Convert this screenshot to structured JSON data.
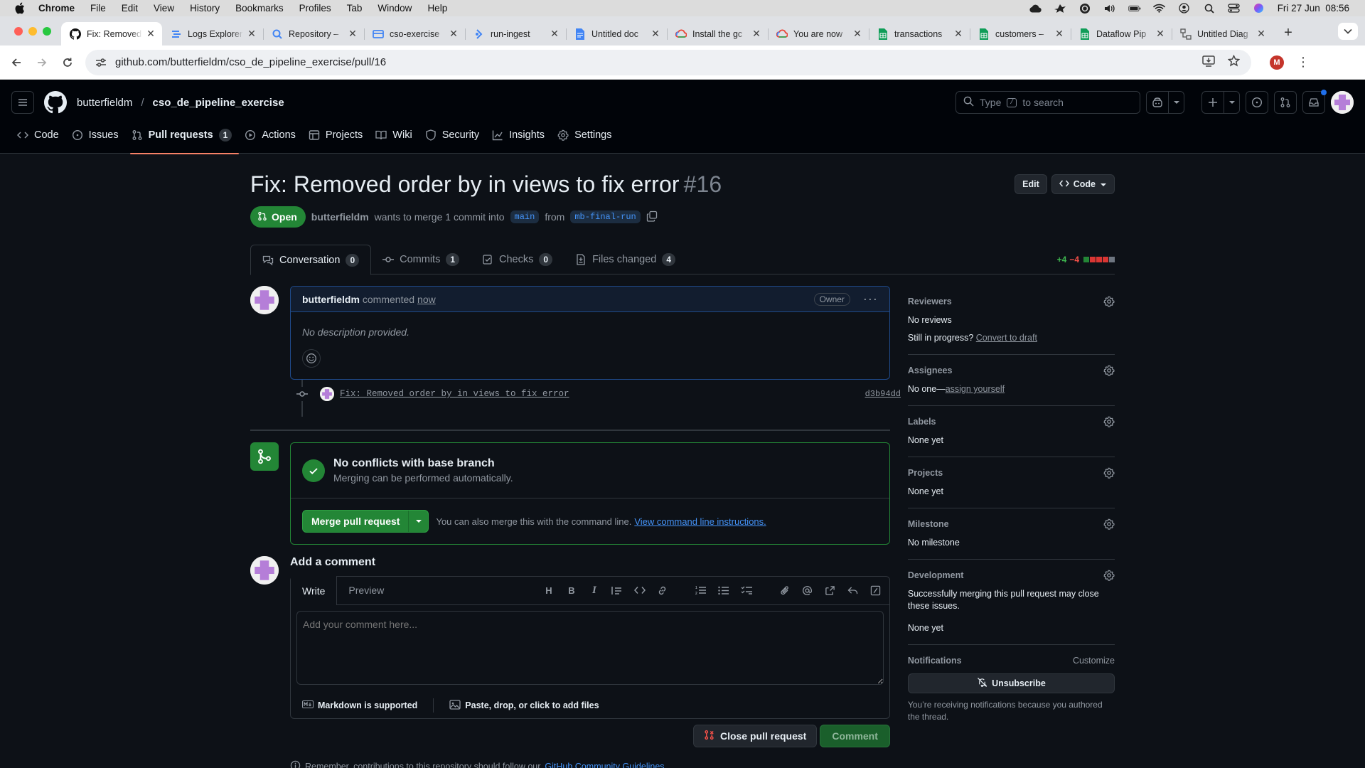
{
  "macbar": {
    "app": "Chrome",
    "menus": [
      "File",
      "Edit",
      "View",
      "History",
      "Bookmarks",
      "Profiles",
      "Tab",
      "Window",
      "Help"
    ],
    "datetime": "Fri 27 Jun  08:56"
  },
  "tabs": [
    {
      "title": "Fix: Removed",
      "icon": "github-icon",
      "active": true
    },
    {
      "title": "Logs Explorer",
      "icon": "logs-explorer-icon"
    },
    {
      "title": "Repository –",
      "icon": "search-repo-icon"
    },
    {
      "title": "cso-exercise",
      "icon": "cloud-build-icon"
    },
    {
      "title": "run-ingest",
      "icon": "workflow-icon"
    },
    {
      "title": "Untitled doc",
      "icon": "google-docs-icon"
    },
    {
      "title": "Install the gc",
      "icon": "google-cloud-icon"
    },
    {
      "title": "You are now",
      "icon": "google-cloud-icon"
    },
    {
      "title": "transactions",
      "icon": "google-sheets-icon"
    },
    {
      "title": "customers –",
      "icon": "google-sheets-icon"
    },
    {
      "title": "Dataflow Pip",
      "icon": "google-sheets-icon"
    },
    {
      "title": "Untitled Diag",
      "icon": "diagram-icon"
    }
  ],
  "address": {
    "url": "github.com/butterfieldm/cso_de_pipeline_exercise/pull/16",
    "profile_initial": "M"
  },
  "repo": {
    "owner": "butterfieldm",
    "name": "cso_de_pipeline_exercise",
    "search_prefix": "Type",
    "search_key": "/",
    "search_suffix": "to search"
  },
  "repo_nav": [
    {
      "label": "Code",
      "icon": "code-icon"
    },
    {
      "label": "Issues",
      "icon": "issue-opened-icon"
    },
    {
      "label": "Pull requests",
      "icon": "git-pull-request-icon",
      "count": "1",
      "active": true
    },
    {
      "label": "Actions",
      "icon": "play-icon"
    },
    {
      "label": "Projects",
      "icon": "table-icon"
    },
    {
      "label": "Wiki",
      "icon": "book-icon"
    },
    {
      "label": "Security",
      "icon": "shield-icon"
    },
    {
      "label": "Insights",
      "icon": "graph-icon"
    },
    {
      "label": "Settings",
      "icon": "gear-icon"
    }
  ],
  "pr": {
    "title": "Fix: Removed order by in views to fix error",
    "number": "#16",
    "edit_label": "Edit",
    "code_label": "Code",
    "state": "Open",
    "author": "butterfieldm",
    "merge_text_1": "wants to merge 1 commit into",
    "base": "main",
    "merge_text_2": "from",
    "head": "mb-final-run",
    "tabs": [
      {
        "label": "Conversation",
        "count": "0",
        "icon": "comment-discussion-icon",
        "active": true
      },
      {
        "label": "Commits",
        "count": "1",
        "icon": "git-commit-icon"
      },
      {
        "label": "Checks",
        "count": "0",
        "icon": "checklist-icon"
      },
      {
        "label": "Files changed",
        "count": "4",
        "icon": "file-diff-icon"
      }
    ],
    "additions": "+4",
    "deletions": "−4"
  },
  "comment": {
    "author": "butterfieldm",
    "action": "commented",
    "time": "now",
    "badge": "Owner",
    "body": "No description provided."
  },
  "commit": {
    "message": "Fix: Removed order by in views to fix error",
    "sha": "d3b94dd"
  },
  "merge": {
    "heading": "No conflicts with base branch",
    "sub": "Merging can be performed automatically.",
    "button": "Merge pull request",
    "hint": "You can also merge this with the command line.",
    "link": "View command line instructions."
  },
  "add_comment": {
    "heading": "Add a comment",
    "tab_write": "Write",
    "tab_preview": "Preview",
    "placeholder": "Add your comment here...",
    "markdown": "Markdown is supported",
    "attach": "Paste, drop, or click to add files",
    "close_label": "Close pull request",
    "comment_label": "Comment",
    "guideline_text": "Remember, contributions to this repository should follow our",
    "guideline_link": "GitHub Community Guidelines",
    "guideline_end": "."
  },
  "sidebar": {
    "reviewers": {
      "label": "Reviewers",
      "value": "No reviews",
      "progress_q": "Still in progress?",
      "progress_link": "Convert to draft"
    },
    "assignees": {
      "label": "Assignees",
      "value": "No one—",
      "link": "assign yourself"
    },
    "labels": {
      "label": "Labels",
      "value": "None yet"
    },
    "projects": {
      "label": "Projects",
      "value": "None yet"
    },
    "milestone": {
      "label": "Milestone",
      "value": "No milestone"
    },
    "development": {
      "label": "Development",
      "desc": "Successfully merging this pull request may close these issues.",
      "value": "None yet"
    },
    "notifications": {
      "label": "Notifications",
      "customize": "Customize",
      "button": "Unsubscribe",
      "note": "You’re receiving notifications because you authored the thread."
    }
  },
  "colors": {
    "open_green": "#238636",
    "accent_blue": "#4493f8",
    "nav_underline": "#f78166",
    "bg": "#0d1117"
  }
}
